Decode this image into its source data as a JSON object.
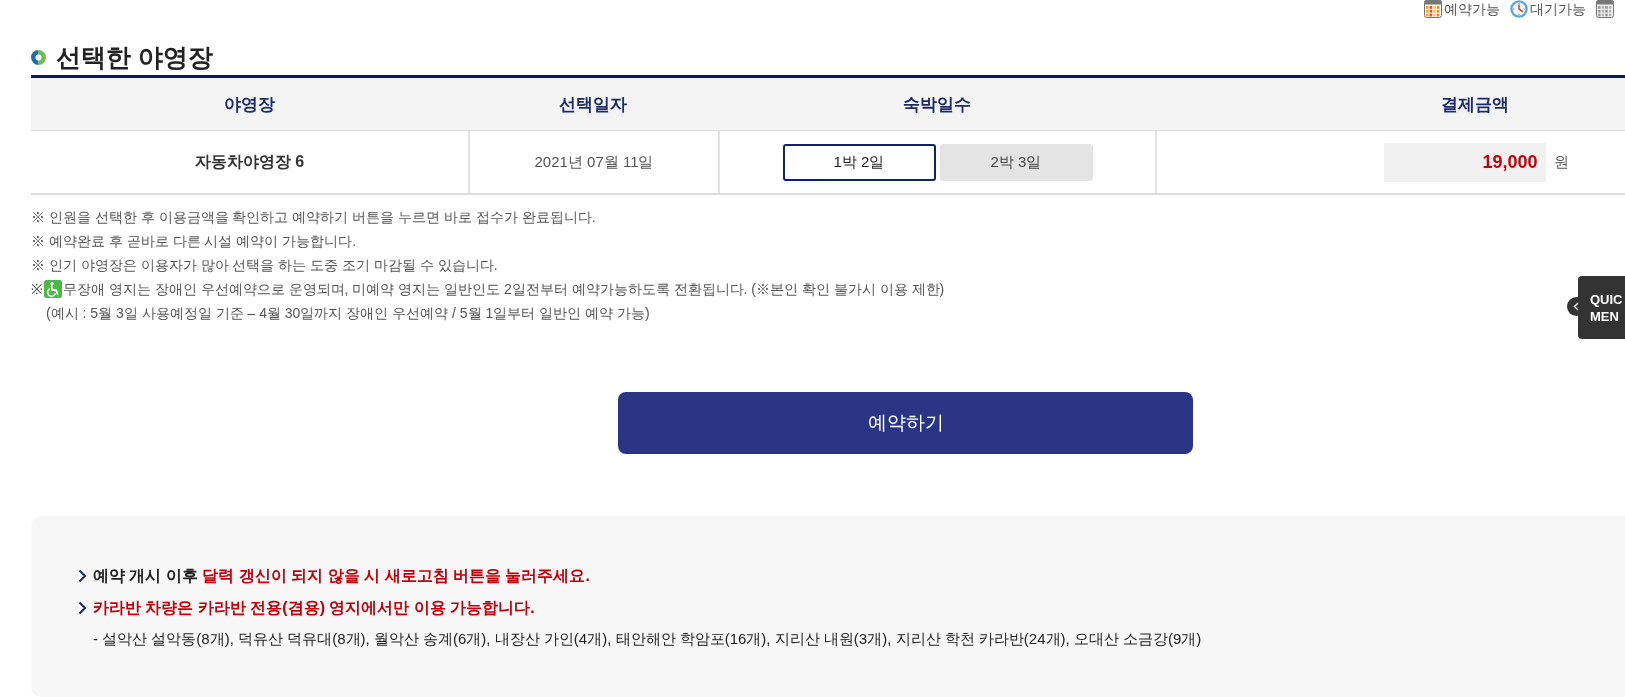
{
  "legend": [
    {
      "kind": "colorgrid",
      "label": "예약가능"
    },
    {
      "kind": "dial",
      "label": "대기가능"
    },
    {
      "kind": "graygrid"
    }
  ],
  "section": {
    "title": "선택한 야영장"
  },
  "table": {
    "columns": [
      "야영장",
      "선택일자",
      "숙박일수",
      "결제금액"
    ],
    "row": {
      "campsite": "자동차야영장 6",
      "date": "2021년 07월 11일",
      "stay_options": [
        {
          "label": "1박 2일",
          "selected": true
        },
        {
          "label": "2박 3일",
          "selected": false
        }
      ],
      "amount": "19,000",
      "currency": "원"
    }
  },
  "notes": [
    {
      "kind": "plain",
      "text": "※ 인원을 선택한 후 이용금액을 확인하고 예약하기 버튼을 누르면 바로 접수가 완료됩니다."
    },
    {
      "kind": "plain",
      "text": "※ 예약완료 후 곧바로 다른 시설 예약이 가능합니다."
    },
    {
      "kind": "plain",
      "text": "※ 인기 야영장은 이용자가 많아 선택을 하는 도중 조기 마감될 수 있습니다."
    },
    {
      "kind": "accessible",
      "mark": "※",
      "text": "무장애 영지는 장애인 우선예약으로 운영되며, 미예약 영지는 일반인도 2일전부터 예약가능하도록 전환됩니다. (※본인 확인 불가시 이용 제한)"
    },
    {
      "kind": "indent",
      "text": "(예시 : 5월 3일 사용예정일 기준 – 4월 30일까지 장애인 우선예약 / 5월 1일부터 일반인 예약 가능)"
    }
  ],
  "reserve_button": {
    "label": "예약하기"
  },
  "notice": {
    "items": [
      {
        "kind": "bullet",
        "segments": [
          {
            "text": "예약 개시 이후 ",
            "emphasis": false
          },
          {
            "text": "달력 갱신이 되지 않을 시 새로고침 버튼을 눌러주세요.",
            "emphasis": true
          }
        ]
      },
      {
        "kind": "bullet",
        "segments": [
          {
            "text": "카라반 차량은 카라반 전용(겸용) 영지에서만 이용 가능합니다.",
            "emphasis": true
          }
        ]
      },
      {
        "kind": "sub",
        "segments": [
          {
            "text": "- 설악산 설악동(8개), 덕유산 덕유대(8개), 월악산 송계(6개), 내장산 가인(4개), 태안해안 학암포(16개), 지리산 내원(3개), 지리산 학천 카라반(24개), 오대산 소금강(9개)",
            "emphasis": false
          }
        ]
      }
    ]
  },
  "quick_menu": {
    "lines": [
      "QUIC",
      "MEN"
    ]
  }
}
